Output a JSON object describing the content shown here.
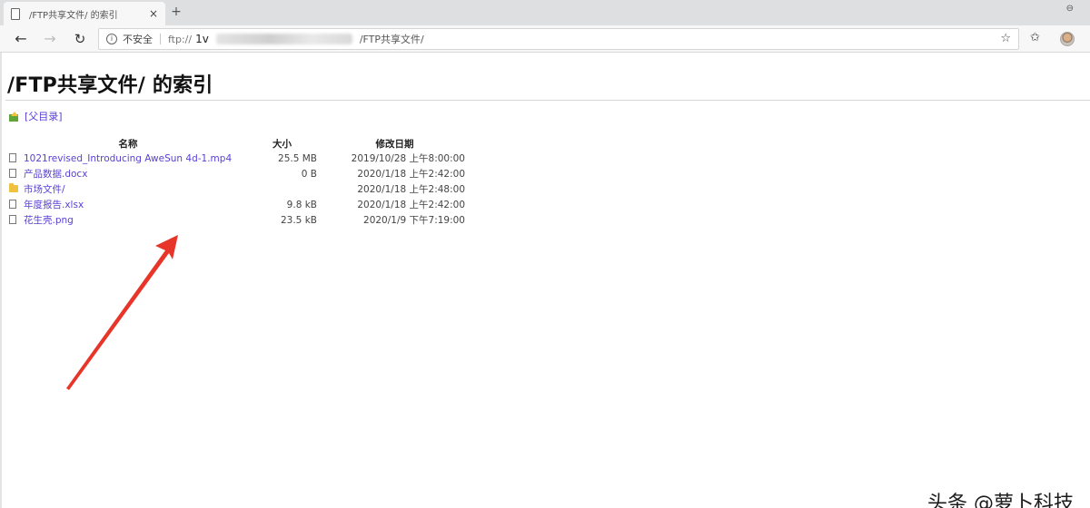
{
  "browser": {
    "tab_title": "/FTP共享文件/ 的索引",
    "tab_close": "×",
    "new_tab": "+",
    "window_control": "⊖",
    "address": {
      "security_text": "不安全",
      "scheme": "ftp://",
      "host_visible": "1v",
      "path": "/FTP共享文件/"
    },
    "icons": {
      "back": "←",
      "forward": "→",
      "reload": "↻",
      "star": "☆",
      "favorites": "✩"
    }
  },
  "page": {
    "title": "/FTP共享文件/ 的索引",
    "parent_link": "[父目录]",
    "columns": {
      "name": "名称",
      "size": "大小",
      "modified": "修改日期"
    },
    "entries": [
      {
        "name": "1021revised_Introducing AweSun 4d-1.mp4",
        "size": "25.5 MB",
        "modified": "2019/10/28 上午8:00:00",
        "kind": "file"
      },
      {
        "name": "产品数据.docx",
        "size": "0 B",
        "modified": "2020/1/18 上午2:42:00",
        "kind": "file"
      },
      {
        "name": "市场文件/",
        "size": "",
        "modified": "2020/1/18 上午2:48:00",
        "kind": "folder"
      },
      {
        "name": "年度报告.xlsx",
        "size": "9.8 kB",
        "modified": "2020/1/18 上午2:42:00",
        "kind": "file"
      },
      {
        "name": "花生壳.png",
        "size": "23.5 kB",
        "modified": "2020/1/9 下午7:19:00",
        "kind": "file"
      }
    ]
  },
  "annotation": {
    "arrow_color": "#e8352a"
  },
  "watermark": "头条 @萝卜科技"
}
